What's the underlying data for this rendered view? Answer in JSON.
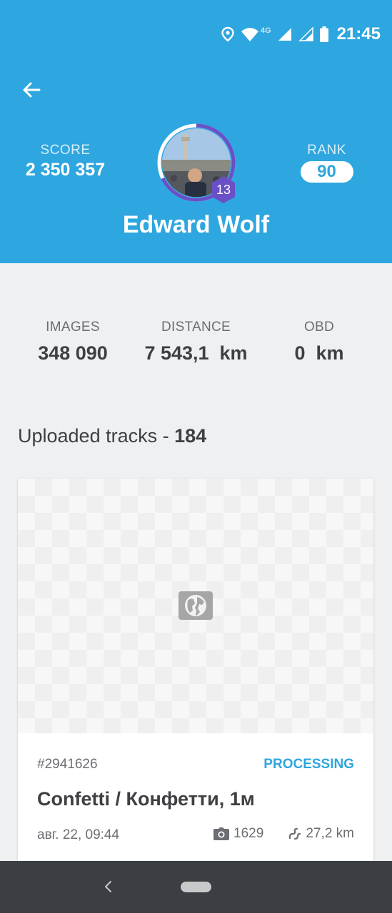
{
  "status_bar": {
    "network": "4G",
    "time": "21:45"
  },
  "header": {
    "score_label": "SCORE",
    "score_value": "2 350 357",
    "rank_label": "RANK",
    "rank_value": "90",
    "level": "13",
    "user_name": "Edward Wolf",
    "level_progress": 0.32
  },
  "stats": {
    "images_label": "IMAGES",
    "images_value": "348 090",
    "distance_label": "DISTANCE",
    "distance_value": "7 543,1  km",
    "obd_label": "OBD",
    "obd_value": "0  km"
  },
  "tracks": {
    "title_prefix": "Uploaded tracks - ",
    "count": "184",
    "items": [
      {
        "id": "#2941626",
        "status": "PROCESSING",
        "title": "Confetti / Конфетти, 1м",
        "date": "авг. 22, 09:44",
        "photos": "1629",
        "distance": "27,2 km"
      }
    ]
  },
  "colors": {
    "header_bg": "#2ea6df",
    "level_badge": "#6a4fc7",
    "accent": "#2ea6df",
    "navbar": "#3b3e43"
  },
  "icons": {
    "back": "arrow-left-icon",
    "location": "location-pin-icon",
    "wifi": "wifi-icon",
    "signal": "cell-signal-icon",
    "battery": "battery-icon",
    "map_placeholder": "globe-icon",
    "camera": "camera-icon",
    "distance": "route-icon"
  }
}
